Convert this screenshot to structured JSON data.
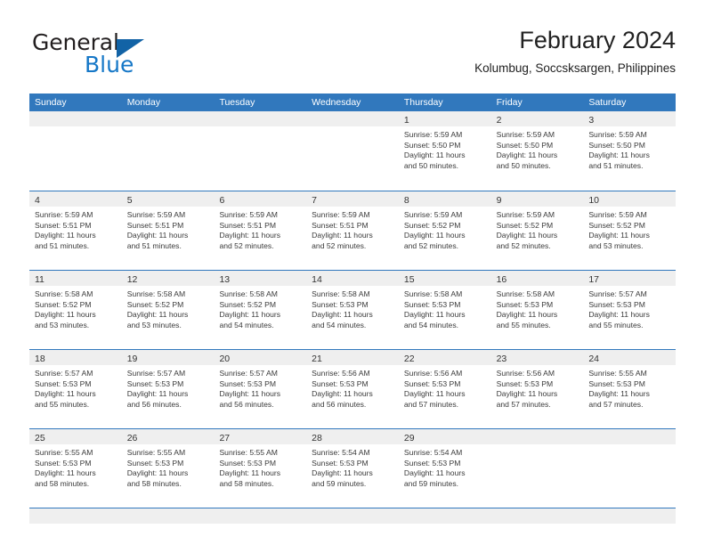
{
  "brand": {
    "name_top": "General",
    "name_bottom": "Blue",
    "accent_color": "#1577c7",
    "triangle_color": "#1263a6"
  },
  "header": {
    "title": "February 2024",
    "subtitle": "Kolumbug, Soccsksargen, Philippines"
  },
  "calendar": {
    "header_color": "#3178bd",
    "weekdays": [
      "Sunday",
      "Monday",
      "Tuesday",
      "Wednesday",
      "Thursday",
      "Friday",
      "Saturday"
    ],
    "weeks": [
      [
        {
          "day": "",
          "lines": []
        },
        {
          "day": "",
          "lines": []
        },
        {
          "day": "",
          "lines": []
        },
        {
          "day": "",
          "lines": []
        },
        {
          "day": "1",
          "lines": [
            "Sunrise: 5:59 AM",
            "Sunset: 5:50 PM",
            "Daylight: 11 hours",
            "and 50 minutes."
          ]
        },
        {
          "day": "2",
          "lines": [
            "Sunrise: 5:59 AM",
            "Sunset: 5:50 PM",
            "Daylight: 11 hours",
            "and 50 minutes."
          ]
        },
        {
          "day": "3",
          "lines": [
            "Sunrise: 5:59 AM",
            "Sunset: 5:50 PM",
            "Daylight: 11 hours",
            "and 51 minutes."
          ]
        }
      ],
      [
        {
          "day": "4",
          "lines": [
            "Sunrise: 5:59 AM",
            "Sunset: 5:51 PM",
            "Daylight: 11 hours",
            "and 51 minutes."
          ]
        },
        {
          "day": "5",
          "lines": [
            "Sunrise: 5:59 AM",
            "Sunset: 5:51 PM",
            "Daylight: 11 hours",
            "and 51 minutes."
          ]
        },
        {
          "day": "6",
          "lines": [
            "Sunrise: 5:59 AM",
            "Sunset: 5:51 PM",
            "Daylight: 11 hours",
            "and 52 minutes."
          ]
        },
        {
          "day": "7",
          "lines": [
            "Sunrise: 5:59 AM",
            "Sunset: 5:51 PM",
            "Daylight: 11 hours",
            "and 52 minutes."
          ]
        },
        {
          "day": "8",
          "lines": [
            "Sunrise: 5:59 AM",
            "Sunset: 5:52 PM",
            "Daylight: 11 hours",
            "and 52 minutes."
          ]
        },
        {
          "day": "9",
          "lines": [
            "Sunrise: 5:59 AM",
            "Sunset: 5:52 PM",
            "Daylight: 11 hours",
            "and 52 minutes."
          ]
        },
        {
          "day": "10",
          "lines": [
            "Sunrise: 5:59 AM",
            "Sunset: 5:52 PM",
            "Daylight: 11 hours",
            "and 53 minutes."
          ]
        }
      ],
      [
        {
          "day": "11",
          "lines": [
            "Sunrise: 5:58 AM",
            "Sunset: 5:52 PM",
            "Daylight: 11 hours",
            "and 53 minutes."
          ]
        },
        {
          "day": "12",
          "lines": [
            "Sunrise: 5:58 AM",
            "Sunset: 5:52 PM",
            "Daylight: 11 hours",
            "and 53 minutes."
          ]
        },
        {
          "day": "13",
          "lines": [
            "Sunrise: 5:58 AM",
            "Sunset: 5:52 PM",
            "Daylight: 11 hours",
            "and 54 minutes."
          ]
        },
        {
          "day": "14",
          "lines": [
            "Sunrise: 5:58 AM",
            "Sunset: 5:53 PM",
            "Daylight: 11 hours",
            "and 54 minutes."
          ]
        },
        {
          "day": "15",
          "lines": [
            "Sunrise: 5:58 AM",
            "Sunset: 5:53 PM",
            "Daylight: 11 hours",
            "and 54 minutes."
          ]
        },
        {
          "day": "16",
          "lines": [
            "Sunrise: 5:58 AM",
            "Sunset: 5:53 PM",
            "Daylight: 11 hours",
            "and 55 minutes."
          ]
        },
        {
          "day": "17",
          "lines": [
            "Sunrise: 5:57 AM",
            "Sunset: 5:53 PM",
            "Daylight: 11 hours",
            "and 55 minutes."
          ]
        }
      ],
      [
        {
          "day": "18",
          "lines": [
            "Sunrise: 5:57 AM",
            "Sunset: 5:53 PM",
            "Daylight: 11 hours",
            "and 55 minutes."
          ]
        },
        {
          "day": "19",
          "lines": [
            "Sunrise: 5:57 AM",
            "Sunset: 5:53 PM",
            "Daylight: 11 hours",
            "and 56 minutes."
          ]
        },
        {
          "day": "20",
          "lines": [
            "Sunrise: 5:57 AM",
            "Sunset: 5:53 PM",
            "Daylight: 11 hours",
            "and 56 minutes."
          ]
        },
        {
          "day": "21",
          "lines": [
            "Sunrise: 5:56 AM",
            "Sunset: 5:53 PM",
            "Daylight: 11 hours",
            "and 56 minutes."
          ]
        },
        {
          "day": "22",
          "lines": [
            "Sunrise: 5:56 AM",
            "Sunset: 5:53 PM",
            "Daylight: 11 hours",
            "and 57 minutes."
          ]
        },
        {
          "day": "23",
          "lines": [
            "Sunrise: 5:56 AM",
            "Sunset: 5:53 PM",
            "Daylight: 11 hours",
            "and 57 minutes."
          ]
        },
        {
          "day": "24",
          "lines": [
            "Sunrise: 5:55 AM",
            "Sunset: 5:53 PM",
            "Daylight: 11 hours",
            "and 57 minutes."
          ]
        }
      ],
      [
        {
          "day": "25",
          "lines": [
            "Sunrise: 5:55 AM",
            "Sunset: 5:53 PM",
            "Daylight: 11 hours",
            "and 58 minutes."
          ]
        },
        {
          "day": "26",
          "lines": [
            "Sunrise: 5:55 AM",
            "Sunset: 5:53 PM",
            "Daylight: 11 hours",
            "and 58 minutes."
          ]
        },
        {
          "day": "27",
          "lines": [
            "Sunrise: 5:55 AM",
            "Sunset: 5:53 PM",
            "Daylight: 11 hours",
            "and 58 minutes."
          ]
        },
        {
          "day": "28",
          "lines": [
            "Sunrise: 5:54 AM",
            "Sunset: 5:53 PM",
            "Daylight: 11 hours",
            "and 59 minutes."
          ]
        },
        {
          "day": "29",
          "lines": [
            "Sunrise: 5:54 AM",
            "Sunset: 5:53 PM",
            "Daylight: 11 hours",
            "and 59 minutes."
          ]
        },
        {
          "day": "",
          "lines": []
        },
        {
          "day": "",
          "lines": []
        }
      ]
    ]
  }
}
